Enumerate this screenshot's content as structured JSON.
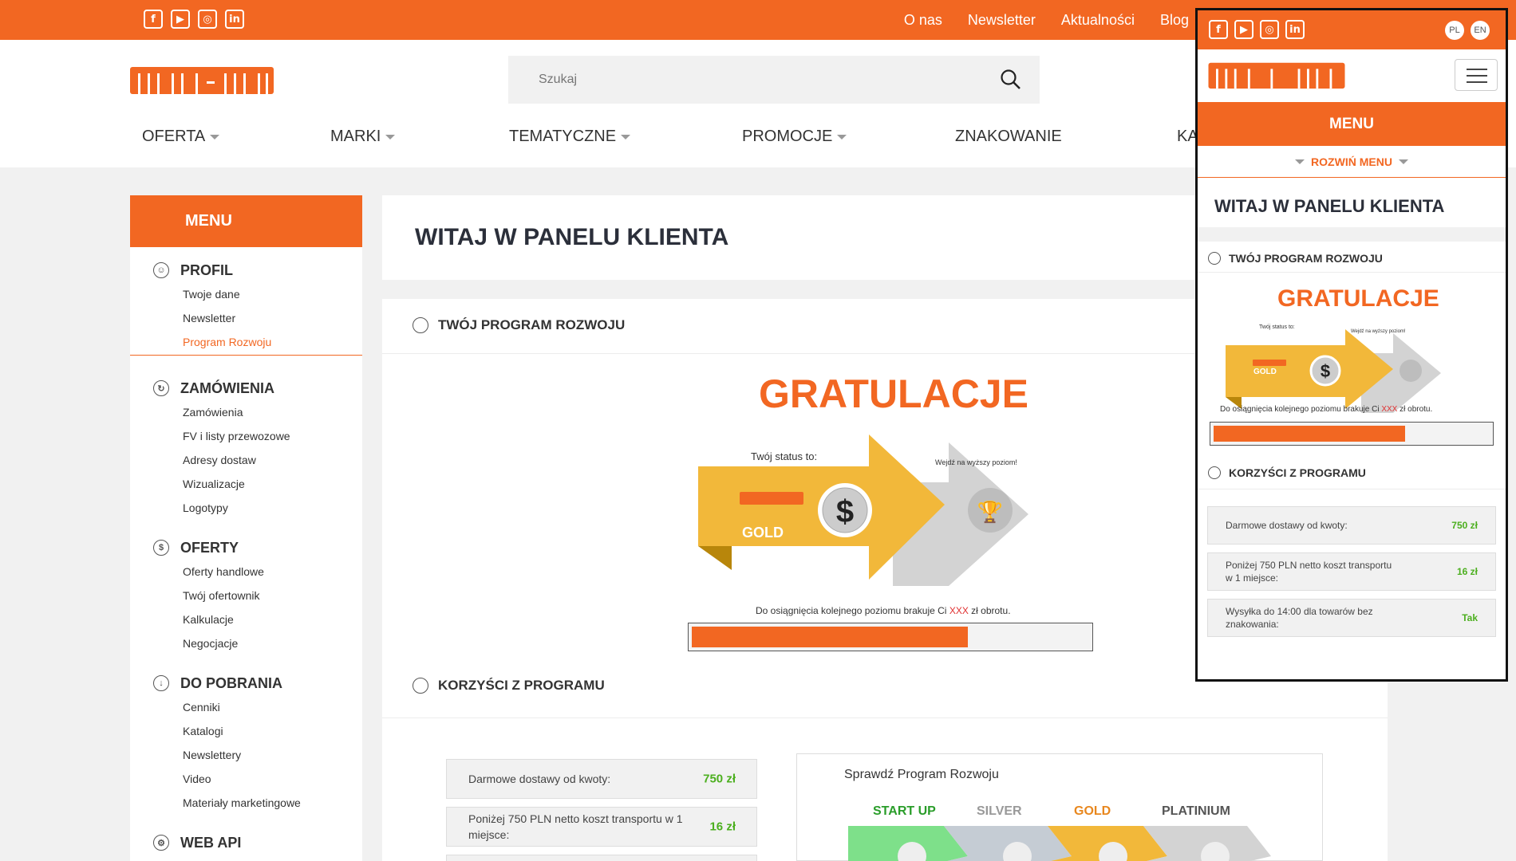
{
  "topbar": {
    "social": [
      "f",
      "▶",
      "◎",
      "in"
    ],
    "links": [
      "O nas",
      "Newsletter",
      "Aktualności",
      "Blog"
    ]
  },
  "search": {
    "placeholder": "Szukaj"
  },
  "mainnav": [
    "OFERTA",
    "MARKI",
    "TEMATYCZNE",
    "PROMOCJE",
    "ZNAKOWANIE",
    "KATALO"
  ],
  "sidebar": {
    "title": "MENU",
    "sections": [
      {
        "title": "PROFIL",
        "items": [
          "Twoje dane",
          "Newsletter",
          "Program Rozwoju"
        ]
      },
      {
        "title": "ZAMÓWIENIA",
        "items": [
          "Zamówienia",
          "FV i listy przewozowe",
          "Adresy dostaw",
          "Wizualizacje",
          "Logotypy"
        ]
      },
      {
        "title": "OFERTY",
        "items": [
          "Oferty handlowe",
          "Twój ofertownik",
          "Kalkulacje",
          "Negocjacje"
        ]
      },
      {
        "title": "DO POBRANIA",
        "items": [
          "Cenniki",
          "Katalogi",
          "Newslettery",
          "Video",
          "Materiały marketingowe"
        ]
      },
      {
        "title": "WEB API",
        "items": []
      }
    ]
  },
  "welcome": "WITAJ W PANELU KLIENTA",
  "program": {
    "title": "TWÓJ PROGRAM ROZWOJU",
    "congrats": "GRATULACJE",
    "status_label": "Twój status to:",
    "next_label": "Wejdź na wyższy poziom!",
    "level": "GOLD",
    "need_text_pre": "Do osiągnięcia kolejnego poziomu brakuje Ci ",
    "need_amount": "XXX",
    "need_text_post": " zł obrotu.",
    "progress": 0.7
  },
  "benefits": {
    "title": "KORZYŚCI Z PROGRAMU",
    "rows": [
      {
        "label": "Darmowe dostawy od kwoty:",
        "value": "750 zł"
      },
      {
        "label": "Poniżej 750 PLN netto koszt transportu w 1 miejsce:",
        "value": "16 zł"
      },
      {
        "label": "Wysyłka do 14:00 dla towarów bez znakowania:",
        "value": "Tak"
      }
    ],
    "check_title": "Sprawdź Program Rozwoju",
    "levels": [
      "START UP",
      "SILVER",
      "GOLD",
      "PLATINIUM"
    ],
    "level_colors": [
      "#2a9d2a",
      "#999999",
      "#e8871e",
      "#555555"
    ]
  },
  "mobile": {
    "langs": [
      "PL",
      "EN"
    ],
    "menu": "MENU",
    "rozwin": "ROZWIŃ MENU"
  },
  "colors": {
    "accent": "#f26722",
    "green": "#4caf1f"
  }
}
